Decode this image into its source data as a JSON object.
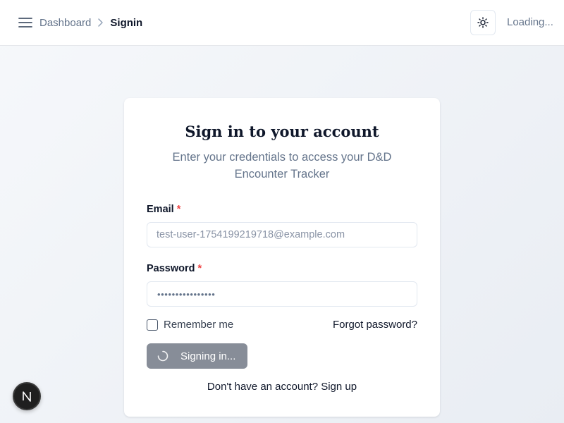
{
  "header": {
    "breadcrumb": {
      "parent": "Dashboard",
      "current": "Signin"
    },
    "user_status": "Loading..."
  },
  "card": {
    "title": "Sign in to your account",
    "subtitle": "Enter your credentials to access your D&D Encounter Tracker",
    "email": {
      "label": "Email",
      "required_mark": "*",
      "placeholder": "test-user-1754199219718@example.com"
    },
    "password": {
      "label": "Password",
      "required_mark": "*",
      "masked_value": "••••••••••••••••"
    },
    "remember_label": "Remember me",
    "remember_checked": false,
    "forgot_label": "Forgot password?",
    "submit_label": "Signing in...",
    "signup_text": "Don't have an account? Sign up"
  },
  "badge": {
    "letter": "N"
  },
  "colors": {
    "button_disabled": "#878d98",
    "required": "#ef4444",
    "muted_text": "#64748b"
  },
  "icons": {
    "menu": "menu-icon",
    "theme": "sun-icon",
    "spinner": "spinner-icon",
    "separator": "chevron-right-icon"
  }
}
